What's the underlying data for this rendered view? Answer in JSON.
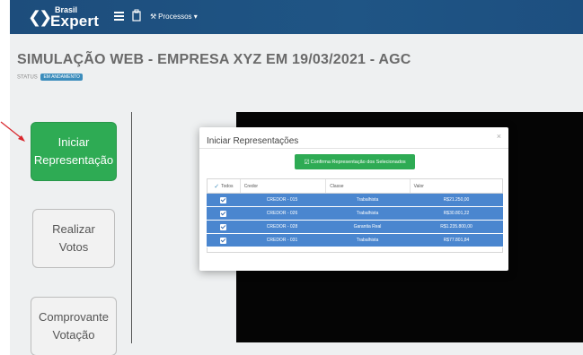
{
  "header": {
    "logo_small": "Brasil",
    "logo_big": "Expert",
    "menu_processes": "Processos"
  },
  "page": {
    "title": "SIMULAÇÃO WEB - EMPRESA XYZ EM 19/03/2021 - AGC",
    "status_label": "STATUS",
    "status_value": "EM ANDAMENTO"
  },
  "sidebar": {
    "iniciar_label": "Iniciar\nRepresentação",
    "realizar_label": "Realizar\nVotos",
    "comprovante_label": "Comprovante\nVotação"
  },
  "modal": {
    "title": "Iniciar Representações",
    "close": "×",
    "confirm_label": "Confirma Representação dos Selecionados",
    "columns": {
      "todos": "Todos",
      "credor": "Credor",
      "classe": "Classe",
      "valor": "Valor"
    },
    "rows": [
      {
        "credor": "CREDOR - 015",
        "classe": "Trabalhista",
        "valor": "R$21.250,00"
      },
      {
        "credor": "CREDOR - 026",
        "classe": "Trabalhista",
        "valor": "R$30.801,22"
      },
      {
        "credor": "CREDOR - 028",
        "classe": "Garantia Real",
        "valor": "R$1.235.800,00"
      },
      {
        "credor": "CREDOR - 031",
        "classe": "Trabalhista",
        "valor": "R$77.801,84"
      }
    ]
  },
  "colors": {
    "topbar": "#1f5585",
    "accent_green": "#2eab54",
    "row_blue": "#4a86cf",
    "annotation_arrow": "#d9262c"
  }
}
